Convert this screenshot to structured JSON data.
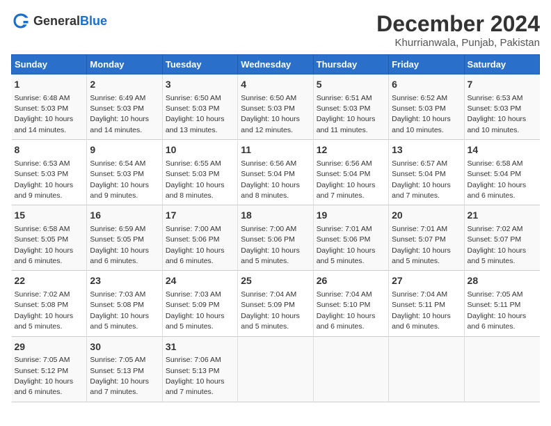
{
  "header": {
    "logo_general": "General",
    "logo_blue": "Blue",
    "title": "December 2024",
    "subtitle": "Khurrianwala, Punjab, Pakistan"
  },
  "columns": [
    "Sunday",
    "Monday",
    "Tuesday",
    "Wednesday",
    "Thursday",
    "Friday",
    "Saturday"
  ],
  "weeks": [
    [
      {
        "day": "1",
        "sunrise": "Sunrise: 6:48 AM",
        "sunset": "Sunset: 5:03 PM",
        "daylight": "Daylight: 10 hours and 14 minutes."
      },
      {
        "day": "2",
        "sunrise": "Sunrise: 6:49 AM",
        "sunset": "Sunset: 5:03 PM",
        "daylight": "Daylight: 10 hours and 14 minutes."
      },
      {
        "day": "3",
        "sunrise": "Sunrise: 6:50 AM",
        "sunset": "Sunset: 5:03 PM",
        "daylight": "Daylight: 10 hours and 13 minutes."
      },
      {
        "day": "4",
        "sunrise": "Sunrise: 6:50 AM",
        "sunset": "Sunset: 5:03 PM",
        "daylight": "Daylight: 10 hours and 12 minutes."
      },
      {
        "day": "5",
        "sunrise": "Sunrise: 6:51 AM",
        "sunset": "Sunset: 5:03 PM",
        "daylight": "Daylight: 10 hours and 11 minutes."
      },
      {
        "day": "6",
        "sunrise": "Sunrise: 6:52 AM",
        "sunset": "Sunset: 5:03 PM",
        "daylight": "Daylight: 10 hours and 10 minutes."
      },
      {
        "day": "7",
        "sunrise": "Sunrise: 6:53 AM",
        "sunset": "Sunset: 5:03 PM",
        "daylight": "Daylight: 10 hours and 10 minutes."
      }
    ],
    [
      {
        "day": "8",
        "sunrise": "Sunrise: 6:53 AM",
        "sunset": "Sunset: 5:03 PM",
        "daylight": "Daylight: 10 hours and 9 minutes."
      },
      {
        "day": "9",
        "sunrise": "Sunrise: 6:54 AM",
        "sunset": "Sunset: 5:03 PM",
        "daylight": "Daylight: 10 hours and 9 minutes."
      },
      {
        "day": "10",
        "sunrise": "Sunrise: 6:55 AM",
        "sunset": "Sunset: 5:03 PM",
        "daylight": "Daylight: 10 hours and 8 minutes."
      },
      {
        "day": "11",
        "sunrise": "Sunrise: 6:56 AM",
        "sunset": "Sunset: 5:04 PM",
        "daylight": "Daylight: 10 hours and 8 minutes."
      },
      {
        "day": "12",
        "sunrise": "Sunrise: 6:56 AM",
        "sunset": "Sunset: 5:04 PM",
        "daylight": "Daylight: 10 hours and 7 minutes."
      },
      {
        "day": "13",
        "sunrise": "Sunrise: 6:57 AM",
        "sunset": "Sunset: 5:04 PM",
        "daylight": "Daylight: 10 hours and 7 minutes."
      },
      {
        "day": "14",
        "sunrise": "Sunrise: 6:58 AM",
        "sunset": "Sunset: 5:04 PM",
        "daylight": "Daylight: 10 hours and 6 minutes."
      }
    ],
    [
      {
        "day": "15",
        "sunrise": "Sunrise: 6:58 AM",
        "sunset": "Sunset: 5:05 PM",
        "daylight": "Daylight: 10 hours and 6 minutes."
      },
      {
        "day": "16",
        "sunrise": "Sunrise: 6:59 AM",
        "sunset": "Sunset: 5:05 PM",
        "daylight": "Daylight: 10 hours and 6 minutes."
      },
      {
        "day": "17",
        "sunrise": "Sunrise: 7:00 AM",
        "sunset": "Sunset: 5:06 PM",
        "daylight": "Daylight: 10 hours and 6 minutes."
      },
      {
        "day": "18",
        "sunrise": "Sunrise: 7:00 AM",
        "sunset": "Sunset: 5:06 PM",
        "daylight": "Daylight: 10 hours and 5 minutes."
      },
      {
        "day": "19",
        "sunrise": "Sunrise: 7:01 AM",
        "sunset": "Sunset: 5:06 PM",
        "daylight": "Daylight: 10 hours and 5 minutes."
      },
      {
        "day": "20",
        "sunrise": "Sunrise: 7:01 AM",
        "sunset": "Sunset: 5:07 PM",
        "daylight": "Daylight: 10 hours and 5 minutes."
      },
      {
        "day": "21",
        "sunrise": "Sunrise: 7:02 AM",
        "sunset": "Sunset: 5:07 PM",
        "daylight": "Daylight: 10 hours and 5 minutes."
      }
    ],
    [
      {
        "day": "22",
        "sunrise": "Sunrise: 7:02 AM",
        "sunset": "Sunset: 5:08 PM",
        "daylight": "Daylight: 10 hours and 5 minutes."
      },
      {
        "day": "23",
        "sunrise": "Sunrise: 7:03 AM",
        "sunset": "Sunset: 5:08 PM",
        "daylight": "Daylight: 10 hours and 5 minutes."
      },
      {
        "day": "24",
        "sunrise": "Sunrise: 7:03 AM",
        "sunset": "Sunset: 5:09 PM",
        "daylight": "Daylight: 10 hours and 5 minutes."
      },
      {
        "day": "25",
        "sunrise": "Sunrise: 7:04 AM",
        "sunset": "Sunset: 5:09 PM",
        "daylight": "Daylight: 10 hours and 5 minutes."
      },
      {
        "day": "26",
        "sunrise": "Sunrise: 7:04 AM",
        "sunset": "Sunset: 5:10 PM",
        "daylight": "Daylight: 10 hours and 6 minutes."
      },
      {
        "day": "27",
        "sunrise": "Sunrise: 7:04 AM",
        "sunset": "Sunset: 5:11 PM",
        "daylight": "Daylight: 10 hours and 6 minutes."
      },
      {
        "day": "28",
        "sunrise": "Sunrise: 7:05 AM",
        "sunset": "Sunset: 5:11 PM",
        "daylight": "Daylight: 10 hours and 6 minutes."
      }
    ],
    [
      {
        "day": "29",
        "sunrise": "Sunrise: 7:05 AM",
        "sunset": "Sunset: 5:12 PM",
        "daylight": "Daylight: 10 hours and 6 minutes."
      },
      {
        "day": "30",
        "sunrise": "Sunrise: 7:05 AM",
        "sunset": "Sunset: 5:13 PM",
        "daylight": "Daylight: 10 hours and 7 minutes."
      },
      {
        "day": "31",
        "sunrise": "Sunrise: 7:06 AM",
        "sunset": "Sunset: 5:13 PM",
        "daylight": "Daylight: 10 hours and 7 minutes."
      },
      {
        "day": "",
        "sunrise": "",
        "sunset": "",
        "daylight": ""
      },
      {
        "day": "",
        "sunrise": "",
        "sunset": "",
        "daylight": ""
      },
      {
        "day": "",
        "sunrise": "",
        "sunset": "",
        "daylight": ""
      },
      {
        "day": "",
        "sunrise": "",
        "sunset": "",
        "daylight": ""
      }
    ]
  ]
}
